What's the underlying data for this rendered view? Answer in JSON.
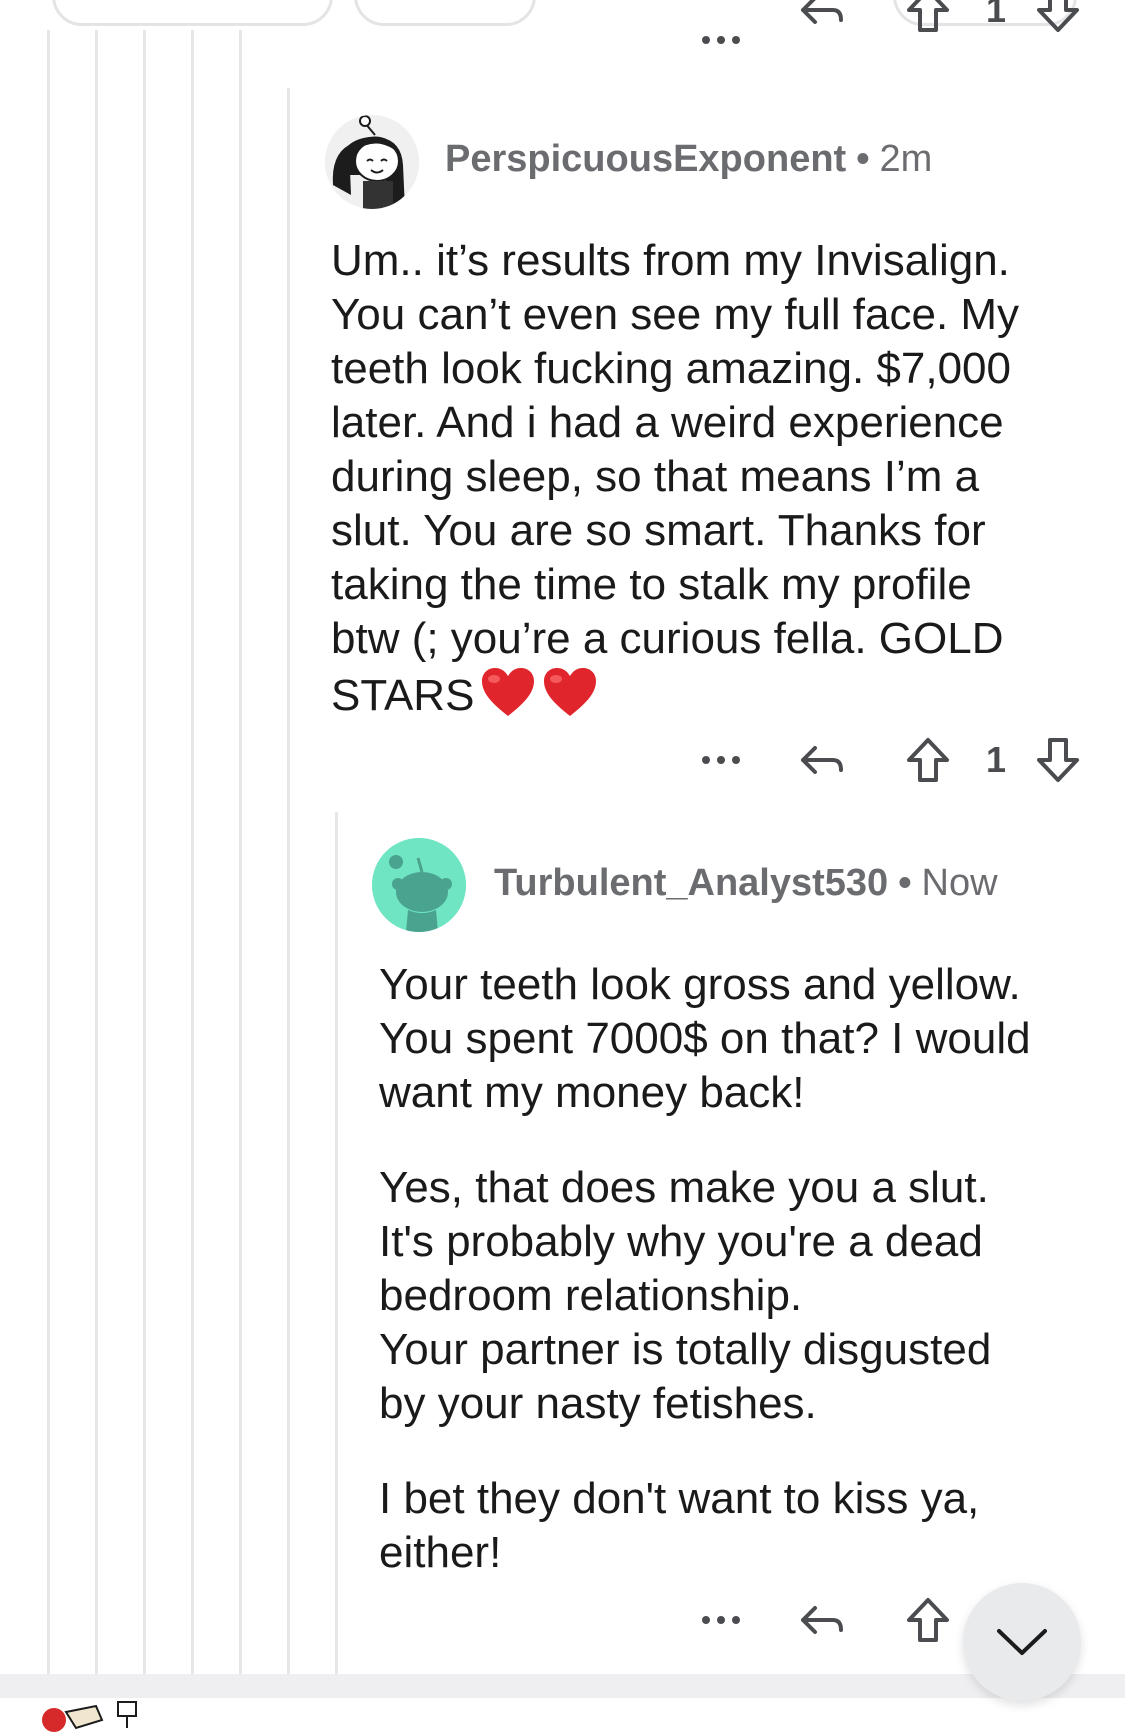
{
  "colors": {
    "thread_line": "#e6e7e9",
    "meta_text": "#6a6c6f",
    "body_text": "#1a1a1b",
    "avatar2_bg": "#6fe5c4",
    "avatar2_snoo": "#4aa38e",
    "heart": "#e0262c",
    "fab_bg": "#e9eaec"
  },
  "top_actions": {
    "more_icon": "more-dots-icon",
    "reply_icon": "reply-arrow-icon",
    "upvote_icon": "upvote-arrow-icon",
    "downvote_icon": "downvote-arrow-icon"
  },
  "comments": [
    {
      "username": "PerspicuousExponent",
      "separator": "•",
      "time": "2m",
      "avatar_icon": "user-avatar-icon",
      "body_lines": [
        "Um.. it’s results from my Invisalign.",
        "You can’t even see my full face. My",
        "teeth look fucking amazing. $7,000",
        "later. And i had a weird experience",
        "during sleep, so that means I’m a",
        "slut. You are so smart. Thanks for",
        "taking the time to stalk my profile",
        "btw (; you’re a curious fella. GOLD",
        "STARS"
      ],
      "emoji": [
        "heart-emoji-icon",
        "heart-emoji-icon"
      ],
      "vote_count": "1"
    },
    {
      "username": "Turbulent_Analyst530",
      "separator": "•",
      "time": "Now",
      "avatar_icon": "snoo-avatar-icon",
      "paragraphs": [
        [
          "Your teeth look gross and yellow.",
          "You spent 7000$ on that? I would",
          "want my money back!"
        ],
        [
          "Yes, that does make you a slut.",
          "It's probably why you're a dead",
          "bedroom relationship.",
          "Your partner is totally disgusted",
          "by your nasty fetishes."
        ],
        [
          "I bet they don't want to kiss ya,",
          "either!"
        ]
      ]
    }
  ],
  "scroll_button_icon": "chevron-down-icon"
}
